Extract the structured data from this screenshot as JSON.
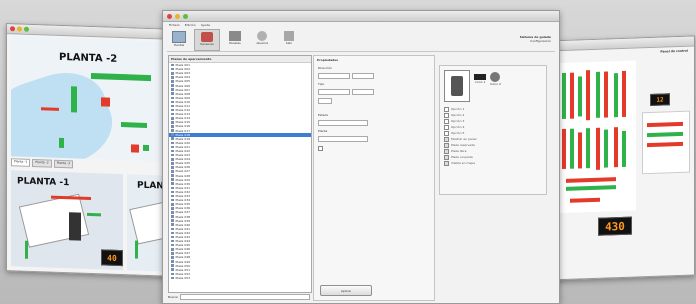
{
  "left_window": {
    "floor_top_label": "PLANTA -2",
    "floor_bottom_label": "PLANTA -1",
    "floor_partial_label": "PLANTA",
    "sign_value": "40",
    "tabs": [
      "Planta -1",
      "Planta -2",
      "Planta -3"
    ]
  },
  "center_window": {
    "menu": [
      "Fichero",
      "Edición",
      "Ayuda"
    ],
    "toolbar": [
      "Plantas",
      "Sensores",
      "Paneles",
      "Usuarios",
      "Salir"
    ],
    "header_title": "Sistema de guiado",
    "header_subtitle": "Configuración",
    "tree_header": "Plazas de aparcamiento",
    "tree_items": [
      "Plaza 001",
      "Plaza 002",
      "Plaza 003",
      "Plaza 004",
      "Plaza 005",
      "Plaza 006",
      "Plaza 007",
      "Plaza 008",
      "Plaza 009",
      "Plaza 010",
      "Plaza 011",
      "Plaza 012",
      "Plaza 013",
      "Plaza 014",
      "Plaza 015",
      "Plaza 016",
      "Plaza 017",
      "Plaza 018",
      "Plaza 019",
      "Plaza 020",
      "Plaza 021",
      "Plaza 022",
      "Plaza 023",
      "Plaza 024",
      "Plaza 025",
      "Plaza 026",
      "Plaza 027",
      "Plaza 028",
      "Plaza 029",
      "Plaza 030",
      "Plaza 031",
      "Plaza 032",
      "Plaza 033",
      "Plaza 034",
      "Plaza 035",
      "Plaza 036",
      "Plaza 037",
      "Plaza 038",
      "Plaza 039",
      "Plaza 040",
      "Plaza 041",
      "Plaza 042",
      "Plaza 043",
      "Plaza 044",
      "Plaza 045",
      "Plaza 046",
      "Plaza 047",
      "Plaza 048",
      "Plaza 049",
      "Plaza 050",
      "Plaza 051",
      "Plaza 052",
      "Plaza 053"
    ],
    "selected_index": 17,
    "search_label": "Buscar",
    "props_title": "Propiedades",
    "props_labels": [
      "Dirección",
      "Tipo",
      "Estado",
      "Planta"
    ],
    "options": [
      "Opción 1",
      "Opción 2",
      "Opción 3",
      "Opción 4",
      "Opción 5",
      "Mostrar en panel",
      "Plaza reservada",
      "Plaza libre",
      "Plaza ocupada",
      "Visible en mapa"
    ],
    "thumb_labels": [
      "Icono 1",
      "Icono 2",
      "Icono 3"
    ],
    "apply_button": "Aplicar"
  },
  "right_window": {
    "title": "Panel de control",
    "sign_value": "430",
    "sign_value_small": "12"
  },
  "colors": {
    "free": "#2fb24a",
    "occupied": "#e33a2a",
    "selection": "#3d7dd8",
    "sign_text": "#ff9a1e"
  }
}
